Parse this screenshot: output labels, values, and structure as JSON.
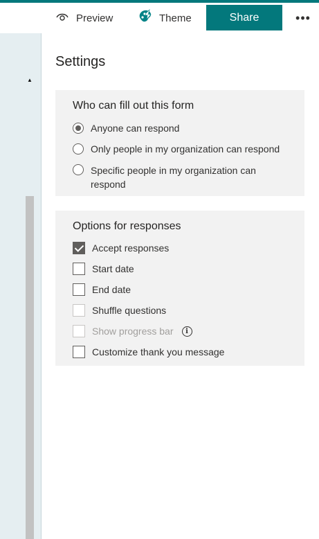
{
  "toolbar": {
    "preview_label": "Preview",
    "theme_label": "Theme",
    "share_label": "Share",
    "more_label": "•••",
    "preview_icon": "eye-icon",
    "theme_icon": "palette-icon",
    "accent_color": "#03787c"
  },
  "settings": {
    "title": "Settings",
    "who": {
      "title": "Who can fill out this form",
      "options": [
        {
          "label": "Anyone can respond",
          "selected": true
        },
        {
          "label": "Only people in my organization can respond",
          "selected": false
        },
        {
          "label": "Specific people in my organization can respond",
          "selected": false
        }
      ]
    },
    "responses": {
      "title": "Options for responses",
      "options": [
        {
          "label": "Accept responses",
          "checked": true,
          "disabled": false
        },
        {
          "label": "Start date",
          "checked": false,
          "disabled": false
        },
        {
          "label": "End date",
          "checked": false,
          "disabled": false
        },
        {
          "label": "Shuffle questions",
          "checked": false,
          "disabled": true
        },
        {
          "label": "Show progress bar",
          "checked": false,
          "disabled": true
        },
        {
          "label": "Customize thank you message",
          "checked": false,
          "disabled": false
        }
      ],
      "info_icon": "info-icon",
      "info_glyph": "i"
    }
  }
}
